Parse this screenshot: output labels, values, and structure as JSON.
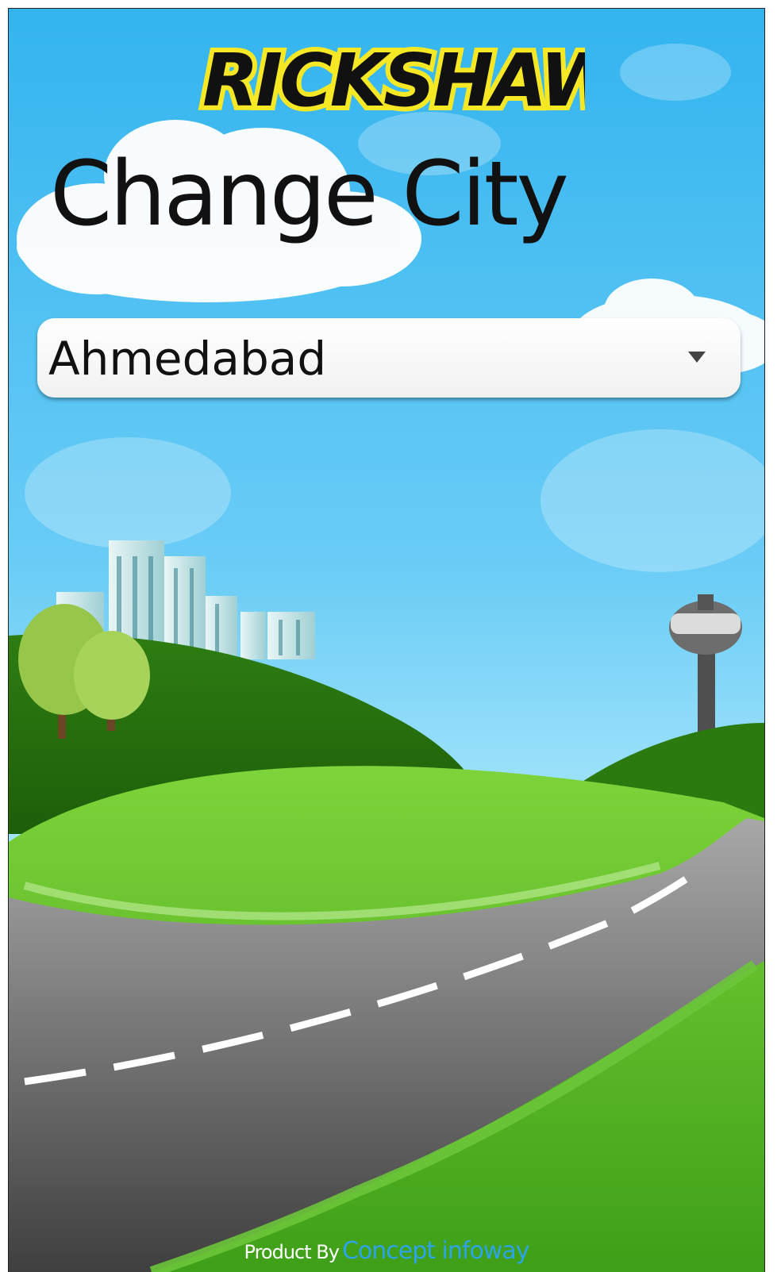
{
  "app": {
    "logo_text": "RICKSHAW",
    "title": "Change City"
  },
  "city_selector": {
    "selected_value": "Ahmedabad",
    "icon": "dropdown-arrow-icon"
  },
  "footer": {
    "prefix": "Product By",
    "brand": "Concept infoway"
  },
  "colors": {
    "sky": "#5cc6f3",
    "grass": "#4fb31c",
    "road": "#8a8a8a",
    "logo_fill": "#111111",
    "logo_outline": "#f7e825",
    "brand_link": "#2da3e8"
  }
}
